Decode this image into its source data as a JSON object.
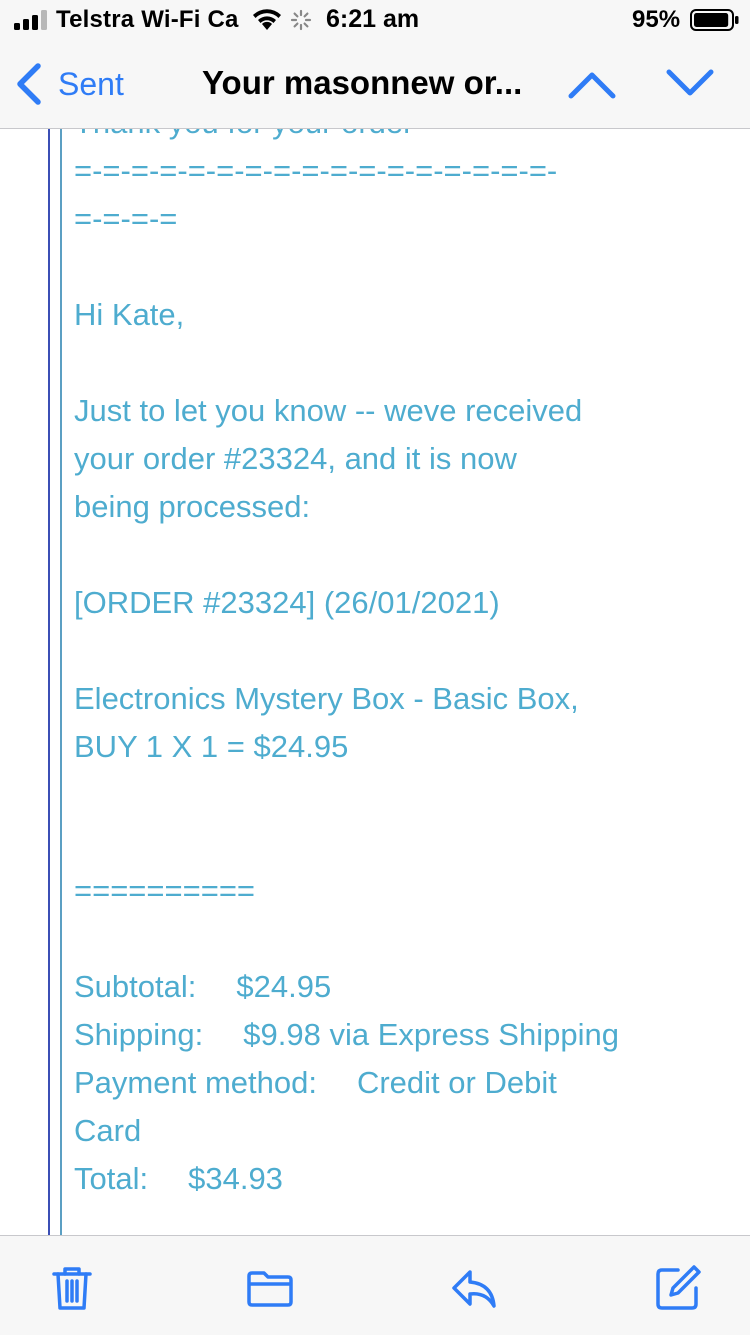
{
  "status_bar": {
    "carrier": "Telstra Wi-Fi Ca",
    "time": "6:21 am",
    "battery_percent": "95%",
    "battery_level": 0.95,
    "icons": [
      "signal-icon",
      "wifi-icon",
      "activity-spinner-icon",
      "battery-icon"
    ]
  },
  "nav": {
    "back_label": "Sent",
    "title": "Your masonnew or...",
    "icons": [
      "chevron-left-icon",
      "chevron-up-icon",
      "chevron-down-icon"
    ]
  },
  "email": {
    "partial_top_line": "Thank you for your order",
    "divider_1a": "=-=-=-=-=-=-=-=-=-=-=-=-=-=-=-=-=-",
    "divider_1b": "=-=-=-=",
    "greeting": "Hi Kate,",
    "intro_1": "Just to let you know -- weve received",
    "intro_2": "your order #23324, and it is now",
    "intro_3": "being processed:",
    "order_header": "[ORDER #23324] (26/01/2021)",
    "item_1": "Electronics Mystery Box - Basic Box,",
    "item_2": "BUY 1 X 1 = $24.95",
    "divider_2": "==========",
    "subtotal_label": "Subtotal:",
    "subtotal_value": "$24.95",
    "shipping_label": "Shipping:",
    "shipping_value": "$9.98 via Express Shipping",
    "payment_label": "Payment method:",
    "payment_value_1": "Credit or Debit",
    "payment_value_2": "Card",
    "total_label": "Total:",
    "total_value": "$34.93"
  },
  "colors": {
    "accent": "#2f7cf6",
    "quoted_text": "#4eaccf",
    "quote_bar_outer": "#3b4fb5",
    "quote_bar_inner": "#5b9fc3",
    "bar_background": "#f7f7f7"
  },
  "toolbar": {
    "icons": [
      "trash-icon",
      "folder-icon",
      "reply-icon",
      "compose-icon"
    ]
  }
}
